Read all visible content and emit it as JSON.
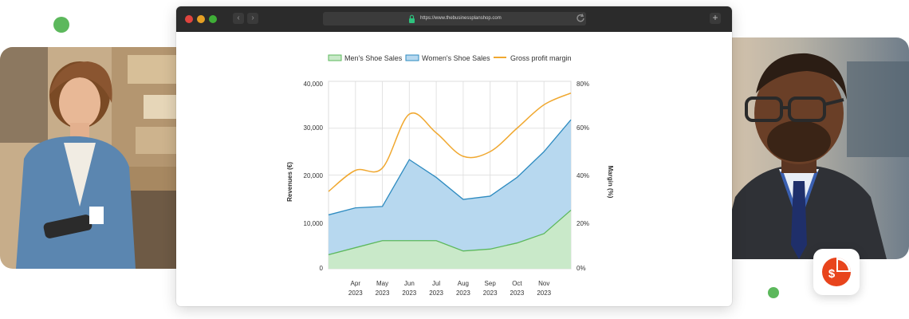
{
  "browser": {
    "url": "https://www.thebusinessplanshop.com"
  },
  "chart_data": {
    "type": "area",
    "categories": [
      "",
      "Apr 2023",
      "May 2023",
      "Jun 2023",
      "Jul 2023",
      "Aug 2023",
      "Sep 2023",
      "Oct 2023",
      "Nov 2023",
      ""
    ],
    "x_labels": [
      {
        "month": "Apr",
        "year": "2023"
      },
      {
        "month": "May",
        "year": "2023"
      },
      {
        "month": "Jun",
        "year": "2023"
      },
      {
        "month": "Jul",
        "year": "2023"
      },
      {
        "month": "Aug",
        "year": "2023"
      },
      {
        "month": "Sep",
        "year": "2023"
      },
      {
        "month": "Oct",
        "year": "2023"
      },
      {
        "month": "Nov",
        "year": "2023"
      }
    ],
    "series": [
      {
        "name": "Men's Shoe Sales",
        "axis": "left",
        "kind": "area",
        "color": "#5cb85c",
        "fill": "#c9e9c9",
        "values": [
          3000,
          4500,
          6000,
          6000,
          6000,
          3800,
          4200,
          5500,
          7500,
          12500
        ]
      },
      {
        "name": "Women's Shoe Sales",
        "axis": "left",
        "kind": "area",
        "color": "#2e8bc0",
        "fill": "#b7d8ef",
        "values": [
          11500,
          13000,
          13300,
          23300,
          19500,
          14800,
          15500,
          19500,
          25000,
          31800
        ]
      },
      {
        "name": "Gross profit margin",
        "axis": "right",
        "kind": "line",
        "color": "#f0a830",
        "values": [
          33,
          42,
          43,
          66,
          58,
          48,
          50,
          60,
          70,
          75
        ]
      }
    ],
    "ylabel": "Revenues (€)",
    "y2label": "Margin (%)",
    "ylim": [
      0,
      40000
    ],
    "y2lim": [
      0,
      80
    ],
    "y_ticks": [
      "0",
      "10,000",
      "20,000",
      "30,000",
      "40,000"
    ],
    "y2_ticks": [
      "0%",
      "20%",
      "40%",
      "60%",
      "80%"
    ],
    "grid": true,
    "legend": "top-center"
  },
  "colors": {
    "green_dot": "#5cb85c",
    "red_dot": "#e8441c",
    "orange_dot": "#f0a030",
    "yellow_dot": "#e0b24a"
  },
  "icons": {
    "left_card": "bar-chart-growth-icon",
    "right_card": "pie-chart-dollar-icon"
  }
}
